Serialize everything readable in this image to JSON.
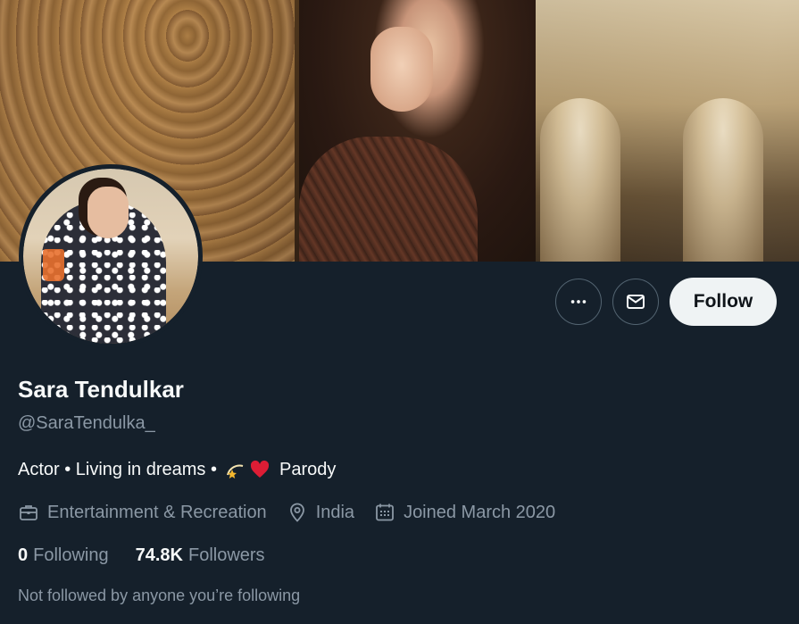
{
  "profile": {
    "name": "Sara Tendulkar",
    "handle": "@SaraTendulka_",
    "bio_text": "Actor • Living in dreams •",
    "bio_suffix": "Parody",
    "bio_emojis": [
      "dizzy-star-emoji",
      "red-heart-emoji"
    ],
    "category": "Entertainment & Recreation",
    "location": "India",
    "joined": "Joined March 2020",
    "following_count": "0",
    "following_label": "Following",
    "followers_count": "74.8K",
    "followers_label": "Followers",
    "mutual_note": "Not followed by anyone you’re following"
  },
  "actions": {
    "more_icon": "more-horizontal-icon",
    "message_icon": "envelope-icon",
    "follow_label": "Follow"
  },
  "colors": {
    "background": "#15202b",
    "primary_text": "#f7f9f9",
    "secondary_text": "#8b98a5",
    "button_border": "#536471",
    "follow_bg": "#eff3f4",
    "follow_text": "#0f1419",
    "heart": "#e0245e"
  }
}
